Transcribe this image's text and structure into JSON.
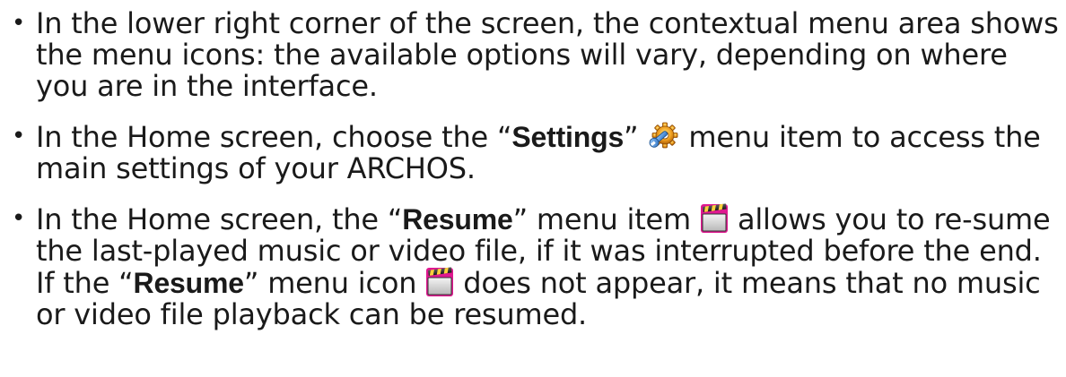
{
  "items": [
    {
      "bullet": "•",
      "text": "In the lower right corner of the screen, the contextual menu area shows the menu icons: the available options will vary, depending on where you are in the interface."
    },
    {
      "bullet": "•",
      "pre": "In the Home screen, choose the “",
      "bold": "Settings",
      "mid": "” ",
      "icon": "settings-icon",
      "post": " menu item to access the main settings of your ARCHOS."
    },
    {
      "bullet": "•",
      "pre": "In the Home screen, the “",
      "bold": "Resume",
      "mid": "” menu item ",
      "icon": "resume-icon",
      "post": " allows you to re-sume the last-played music or video file, if it was interrupted before the end. If the “",
      "bold2": "Resume",
      "mid2": "” menu icon ",
      "icon2": "resume-icon",
      "post2": " does not appear, it means that no music or video file playback can be resumed."
    }
  ]
}
